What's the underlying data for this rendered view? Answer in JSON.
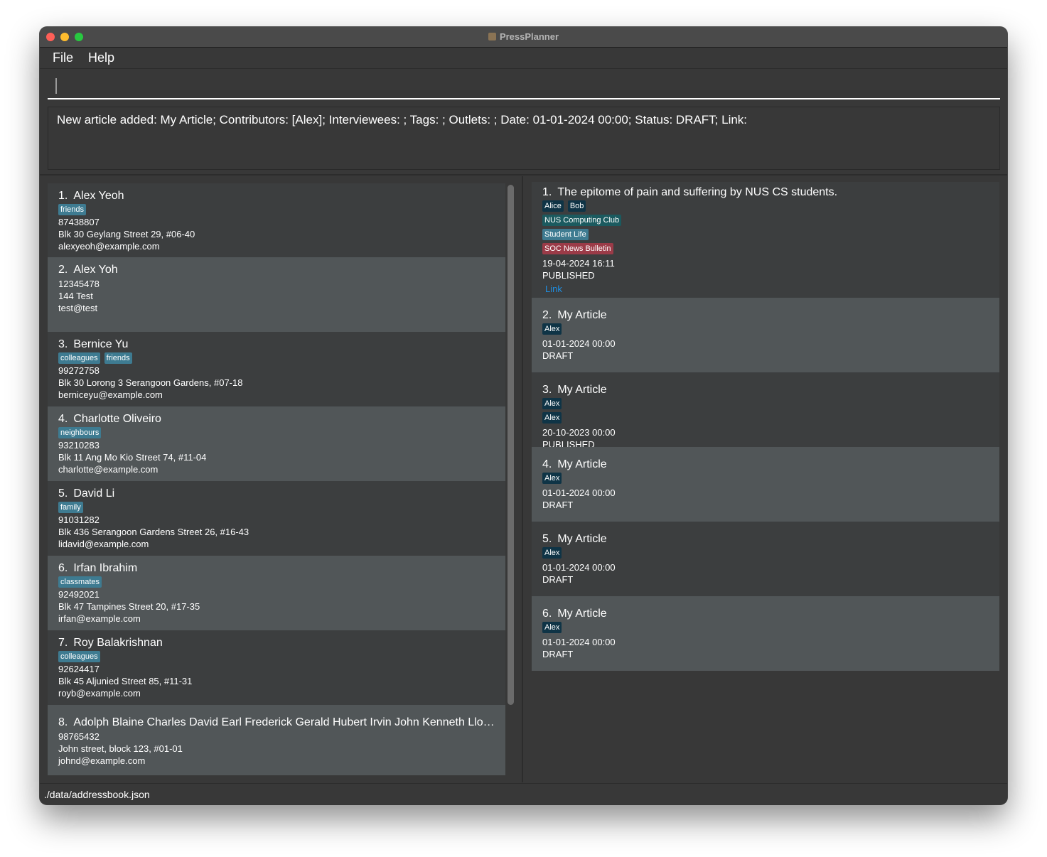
{
  "window": {
    "title": "PressPlanner"
  },
  "menu": [
    {
      "label": "File"
    },
    {
      "label": "Help"
    }
  ],
  "command": {
    "value": ""
  },
  "result": {
    "text": "New article added: My Article; Contributors: [Alex]; Interviewees: ; Tags: ; Outlets: ; Date: 01-01-2024 00:00; Status: DRAFT; Link:"
  },
  "colors": {
    "tag": "#3e7b91",
    "person": "#0f3446",
    "outlet": "#1b5a5f",
    "article_tag": "#3e7b91",
    "outlet_red": "#9b3b48",
    "link": "#1f8ee0"
  },
  "persons": [
    {
      "index": "1.",
      "name": "Alex Yeoh",
      "tags": [
        "friends"
      ],
      "phone": "87438807",
      "address": "Blk 30 Geylang Street 29, #06-40",
      "email": "alexyeoh@example.com"
    },
    {
      "index": "2.",
      "name": "Alex Yoh",
      "tags": [],
      "phone": "12345478",
      "address": "144 Test",
      "email": "test@test"
    },
    {
      "index": "3.",
      "name": "Bernice Yu",
      "tags": [
        "colleagues",
        "friends"
      ],
      "phone": "99272758",
      "address": "Blk 30 Lorong 3 Serangoon Gardens, #07-18",
      "email": "berniceyu@example.com"
    },
    {
      "index": "4.",
      "name": "Charlotte Oliveiro",
      "tags": [
        "neighbours"
      ],
      "phone": "93210283",
      "address": "Blk 11 Ang Mo Kio Street 74, #11-04",
      "email": "charlotte@example.com"
    },
    {
      "index": "5.",
      "name": "David Li",
      "tags": [
        "family"
      ],
      "phone": "91031282",
      "address": "Blk 436 Serangoon Gardens Street 26, #16-43",
      "email": "lidavid@example.com"
    },
    {
      "index": "6.",
      "name": "Irfan Ibrahim",
      "tags": [
        "classmates"
      ],
      "phone": "92492021",
      "address": "Blk 47 Tampines Street 20, #17-35",
      "email": "irfan@example.com"
    },
    {
      "index": "7.",
      "name": "Roy Balakrishnan",
      "tags": [
        "colleagues"
      ],
      "phone": "92624417",
      "address": "Blk 45 Aljunied Street 85, #11-31",
      "email": "royb@example.com"
    },
    {
      "index": "8.",
      "name": "Adolph Blaine Charles David Earl Frederick Gerald Hubert Irvin John Kenneth Lloyd Marti...",
      "tags": [],
      "phone": "98765432",
      "address": "John street, block 123, #01-01",
      "email": "johnd@example.com"
    }
  ],
  "articles": [
    {
      "index": "1.",
      "title": "The epitome of pain and suffering by NUS CS students.",
      "tag_rows": [
        {
          "kind": "person",
          "items": [
            "Alice",
            "Bob"
          ]
        },
        {
          "kind": "outlet",
          "items": [
            "NUS Computing Club"
          ]
        },
        {
          "kind": "article_tag",
          "items": [
            "Student Life"
          ]
        },
        {
          "kind": "outlet_red",
          "items": [
            "SOC News Bulletin"
          ]
        }
      ],
      "date": "19-04-2024 16:11",
      "status": "PUBLISHED",
      "link": "Link"
    },
    {
      "index": "2.",
      "title": "My Article",
      "tag_rows": [
        {
          "kind": "person",
          "items": [
            "Alex"
          ]
        }
      ],
      "date": "01-01-2024 00:00",
      "status": "DRAFT"
    },
    {
      "index": "3.",
      "title": "My Article",
      "tag_rows": [
        {
          "kind": "person",
          "items": [
            "Alex"
          ]
        },
        {
          "kind": "person",
          "items": [
            "Alex"
          ]
        }
      ],
      "date": "20-10-2023 00:00",
      "status": "PUBLISHED"
    },
    {
      "index": "4.",
      "title": "My Article",
      "tag_rows": [
        {
          "kind": "person",
          "items": [
            "Alex"
          ]
        }
      ],
      "date": "01-01-2024 00:00",
      "status": "DRAFT"
    },
    {
      "index": "5.",
      "title": "My Article",
      "tag_rows": [
        {
          "kind": "person",
          "items": [
            "Alex"
          ]
        }
      ],
      "date": "01-01-2024 00:00",
      "status": "DRAFT"
    },
    {
      "index": "6.",
      "title": "My Article",
      "tag_rows": [
        {
          "kind": "person",
          "items": [
            "Alex"
          ]
        }
      ],
      "date": "01-01-2024 00:00",
      "status": "DRAFT"
    }
  ],
  "status_bar": {
    "path": "./data/addressbook.json"
  }
}
